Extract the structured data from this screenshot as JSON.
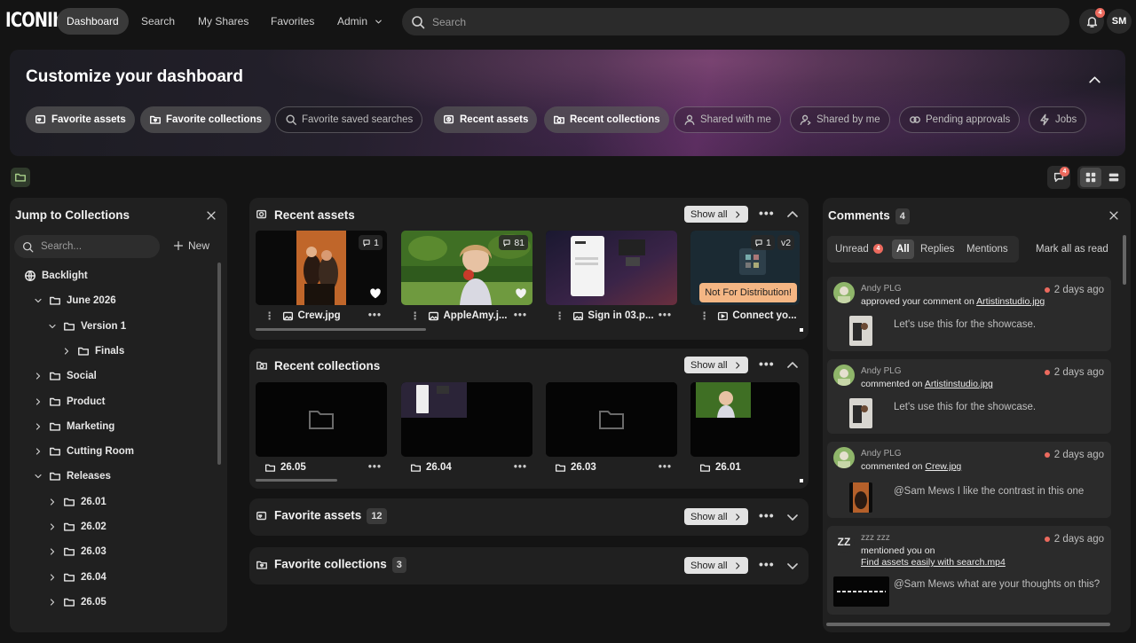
{
  "app": {
    "logo": "ICONIK",
    "user_initials": "SM",
    "notif_count": "4"
  },
  "nav": [
    {
      "label": "Dashboard",
      "active": true
    },
    {
      "label": "Search"
    },
    {
      "label": "My Shares"
    },
    {
      "label": "Favorites"
    },
    {
      "label": "Admin"
    }
  ],
  "search": {
    "placeholder": "Search"
  },
  "banner": {
    "title": "Customize your dashboard",
    "chips": [
      {
        "label": "Favorite assets",
        "on": true
      },
      {
        "label": "Favorite collections",
        "on": true
      },
      {
        "label": "Favorite saved searches",
        "on": false
      },
      {
        "label": "Recent assets",
        "on": true
      },
      {
        "label": "Recent collections",
        "on": true
      },
      {
        "label": "Shared with me",
        "on": false
      },
      {
        "label": "Shared by me",
        "on": false
      },
      {
        "label": "Pending approvals",
        "on": false
      },
      {
        "label": "Jobs",
        "on": false
      }
    ]
  },
  "toolbar": {
    "comment_badge": "4"
  },
  "collections": {
    "title": "Jump to Collections",
    "search_placeholder": "Search...",
    "new_label": "New",
    "tree": [
      {
        "label": "Backlight",
        "depth": 0,
        "icon": "globe",
        "caret": ""
      },
      {
        "label": "June 2026",
        "depth": 1,
        "icon": "folder",
        "caret": "down"
      },
      {
        "label": "Version 1",
        "depth": 2,
        "icon": "folder",
        "caret": "down"
      },
      {
        "label": "Finals",
        "depth": 3,
        "icon": "folder",
        "caret": "right"
      },
      {
        "label": "Social",
        "depth": 1,
        "icon": "folder",
        "caret": "right"
      },
      {
        "label": "Product",
        "depth": 1,
        "icon": "folder",
        "caret": "right"
      },
      {
        "label": "Marketing",
        "depth": 1,
        "icon": "folder",
        "caret": "right"
      },
      {
        "label": "Cutting Room",
        "depth": 1,
        "icon": "folder",
        "caret": "right"
      },
      {
        "label": "Releases",
        "depth": 1,
        "icon": "folder",
        "caret": "down"
      },
      {
        "label": "26.01",
        "depth": 2,
        "icon": "folder",
        "caret": "right"
      },
      {
        "label": "26.02",
        "depth": 2,
        "icon": "folder",
        "caret": "right"
      },
      {
        "label": "26.03",
        "depth": 2,
        "icon": "folder",
        "caret": "right"
      },
      {
        "label": "26.04",
        "depth": 2,
        "icon": "folder",
        "caret": "right"
      },
      {
        "label": "26.05",
        "depth": 2,
        "icon": "folder",
        "caret": "right"
      }
    ]
  },
  "sections": {
    "show_all": "Show all",
    "recent_assets": {
      "title": "Recent assets",
      "items": [
        {
          "name": "Crew.jpg",
          "comments": "1",
          "favorited": true,
          "type": "image"
        },
        {
          "name": "AppleAmy.j...",
          "comments": "81",
          "favorited": true,
          "type": "image"
        },
        {
          "name": "Sign in 03.p...",
          "type": "image"
        },
        {
          "name": "Connect yo...",
          "comments": "1",
          "version": "v2",
          "tag": "Not For Distribution!",
          "type": "video"
        }
      ]
    },
    "recent_collections": {
      "title": "Recent collections",
      "items": [
        {
          "name": "26.05"
        },
        {
          "name": "26.04"
        },
        {
          "name": "26.03"
        },
        {
          "name": "26.01"
        }
      ]
    },
    "favorite_assets": {
      "title": "Favorite assets",
      "count": "12"
    },
    "favorite_collections": {
      "title": "Favorite collections",
      "count": "3"
    }
  },
  "comments": {
    "title": "Comments",
    "count": "4",
    "tabs": {
      "unread": "Unread",
      "unread_count": "4",
      "all": "All",
      "replies": "Replies",
      "mentions": "Mentions"
    },
    "mark_all_read": "Mark all as read",
    "items": [
      {
        "user": "Andy PLG",
        "action": "approved your comment on",
        "target": "Artistinstudio.jpg",
        "time": "2 days ago",
        "text": "Let's use this for the showcase."
      },
      {
        "user": "Andy PLG",
        "action": "commented on",
        "target": "Artistinstudio.jpg",
        "time": "2 days ago",
        "text": "Let's use this for the showcase."
      },
      {
        "user": "Andy PLG",
        "action": "commented on",
        "target": "Crew.jpg",
        "time": "2 days ago",
        "text": "@Sam Mews I like the contrast in this one"
      },
      {
        "user": "zzz zzz",
        "initials": "ZZ",
        "action": "mentioned you on",
        "target": "Find assets easily with search.mp4",
        "time": "2 days ago",
        "text": "@Sam Mews what are your thoughts on this?"
      }
    ]
  }
}
